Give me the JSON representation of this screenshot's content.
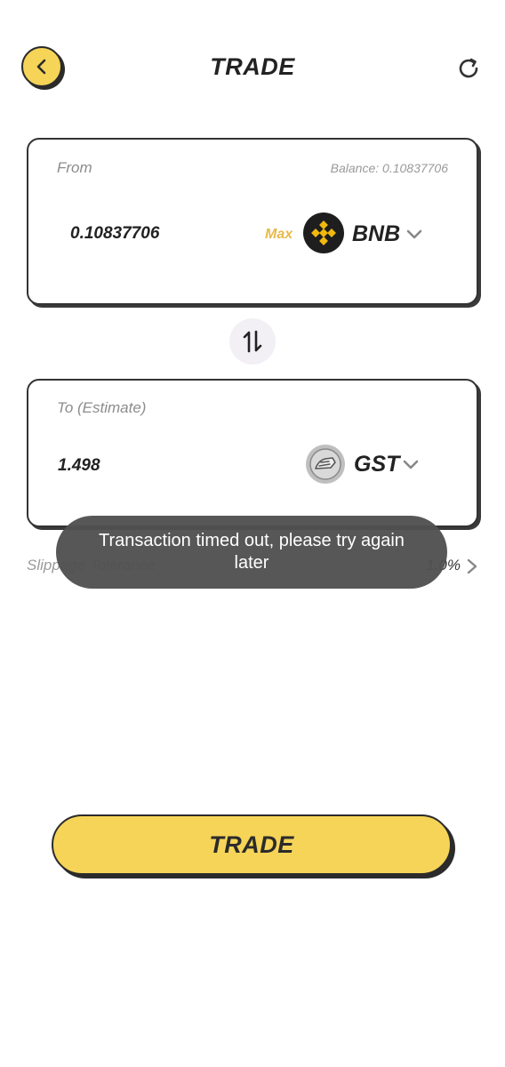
{
  "header": {
    "title": "TRADE",
    "back_icon": "chevron-left-icon",
    "refresh_icon": "refresh-icon"
  },
  "from": {
    "label": "From",
    "balance": "Balance: 0.10837706",
    "amount": "0.10837706",
    "max_label": "Max",
    "token": "BNB",
    "token_icon": "bnb-logo-icon"
  },
  "swap_icon": "swap-arrows-icon",
  "to": {
    "label": "To (Estimate)",
    "amount": "1.498",
    "token": "GST",
    "token_icon": "gst-logo-icon"
  },
  "slippage": {
    "label": "Slippage Tolerance",
    "value": "1.0%"
  },
  "toast": {
    "message": "Transaction timed out, please try again later"
  },
  "trade_button": {
    "label": "TRADE"
  },
  "colors": {
    "accent_yellow": "#f6d458",
    "max_gold": "#e8b94a",
    "outline": "#2b2b2b"
  }
}
